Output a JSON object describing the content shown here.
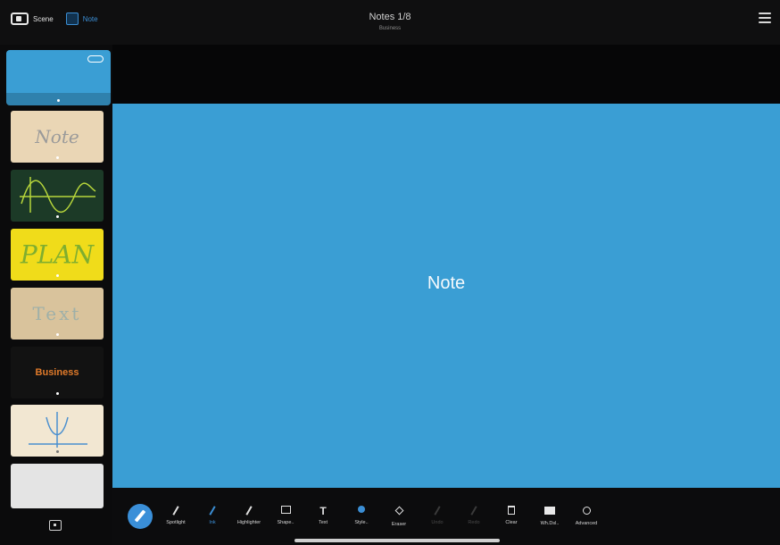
{
  "topbar": {
    "scene_label": "Scene",
    "note_label": "Note",
    "title": "Notes 1/8",
    "subtitle": "Business"
  },
  "sidebar": {
    "thumbnails": [
      {
        "label": "",
        "color": "#3a9ed4",
        "text_color": "#ffffff"
      },
      {
        "label": "Note",
        "color": "#ead6b5",
        "text_color": "#9a9a9a"
      },
      {
        "label": "",
        "color": "#1c3a27",
        "text_color": "#b7d63b"
      },
      {
        "label": "PLAN",
        "color": "#f0dc1a",
        "text_color": "#7fae2f"
      },
      {
        "label": "Text",
        "color": "#d9c39c",
        "text_color": "#9fb0a8"
      },
      {
        "label": "Business",
        "color": "#121212",
        "text_color": "#e07a2a"
      },
      {
        "label": "",
        "color": "#f2e7d2",
        "text_color": "#4a8fcf"
      },
      {
        "label": "",
        "color": "#e4e4e4",
        "text_color": "#999999"
      }
    ]
  },
  "canvas": {
    "text": "Note",
    "background": "#3a9ed4"
  },
  "toolbar": {
    "tools": [
      {
        "name": "spotlight",
        "label": "Spotlight",
        "icon": "spotlight-icon"
      },
      {
        "name": "ink",
        "label": "Ink",
        "icon": "pen-icon"
      },
      {
        "name": "highlighter",
        "label": "Highlighter",
        "icon": "highlighter-icon"
      },
      {
        "name": "shapes",
        "label": "Shape..",
        "icon": "shape-icon"
      },
      {
        "name": "text",
        "label": "Text",
        "icon": "text-icon"
      },
      {
        "name": "style",
        "label": "Style..",
        "icon": "color-dot-icon"
      },
      {
        "name": "eraser",
        "label": "Eraser",
        "icon": "eraser-icon"
      },
      {
        "name": "undo",
        "label": "Undo",
        "icon": "undo-icon"
      },
      {
        "name": "redo",
        "label": "Redo",
        "icon": "redo-icon"
      },
      {
        "name": "clear",
        "label": "Clear",
        "icon": "trash-icon"
      },
      {
        "name": "display",
        "label": "Wh.Dsl..",
        "icon": "screen-icon"
      },
      {
        "name": "advanced",
        "label": "Advanced",
        "icon": "gear-icon"
      }
    ]
  },
  "colors": {
    "accent": "#3b8ed4",
    "canvas": "#3a9ed4"
  }
}
